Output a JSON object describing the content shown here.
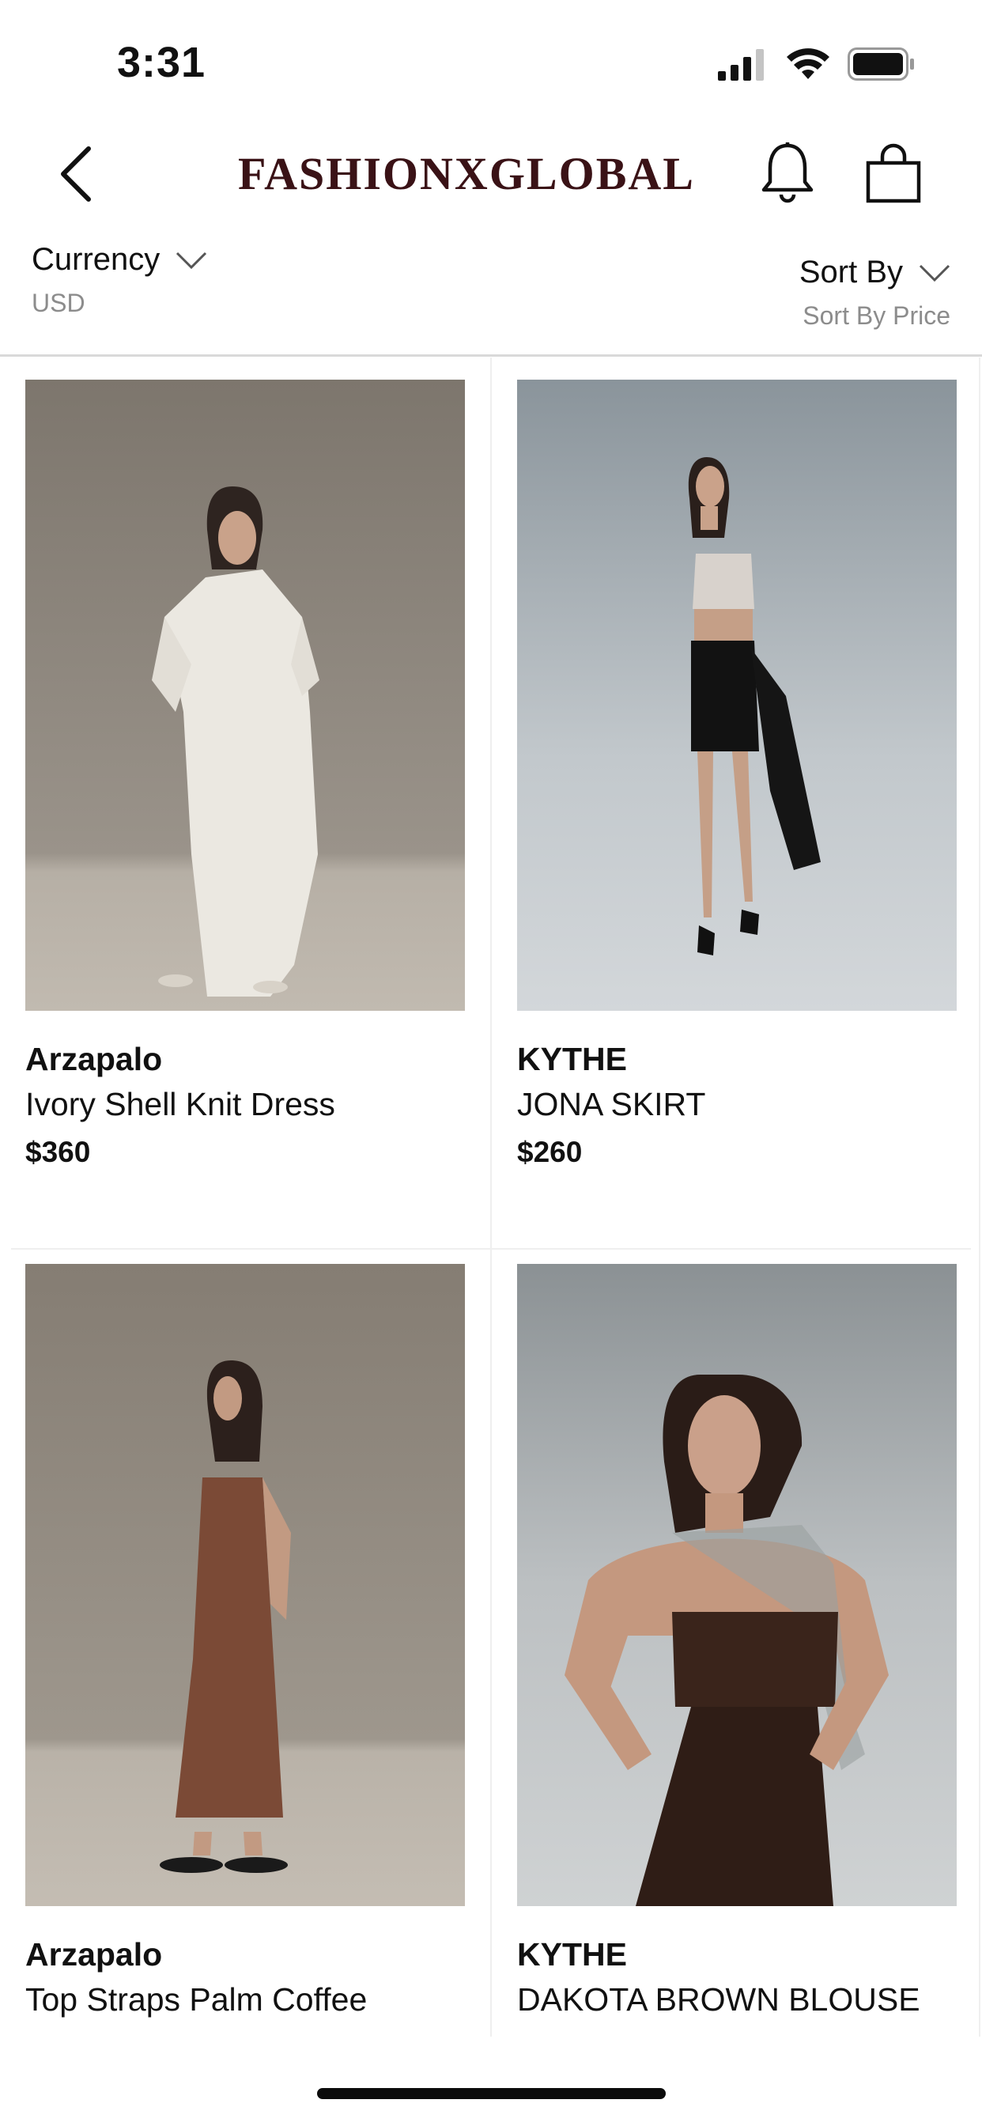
{
  "status_bar": {
    "time": "3:31"
  },
  "header": {
    "brand": "FASHIONXGLOBAL"
  },
  "filters": {
    "currency": {
      "label": "Currency",
      "value": "USD"
    },
    "sort": {
      "label": "Sort By",
      "value": "Sort By Price"
    }
  },
  "products": [
    {
      "brand": "Arzapalo",
      "name": "Ivory Shell Knit Dress",
      "price": "$360"
    },
    {
      "brand": "KYTHE",
      "name": "JONA SKIRT",
      "price": "$260"
    },
    {
      "brand": "Arzapalo",
      "name": "Top Straps Palm Coffee"
    },
    {
      "brand": "KYTHE",
      "name": "DAKOTA BROWN BLOUSE"
    }
  ],
  "colors": {
    "brand": "#3a1216",
    "muted": "#8c8c8c"
  }
}
